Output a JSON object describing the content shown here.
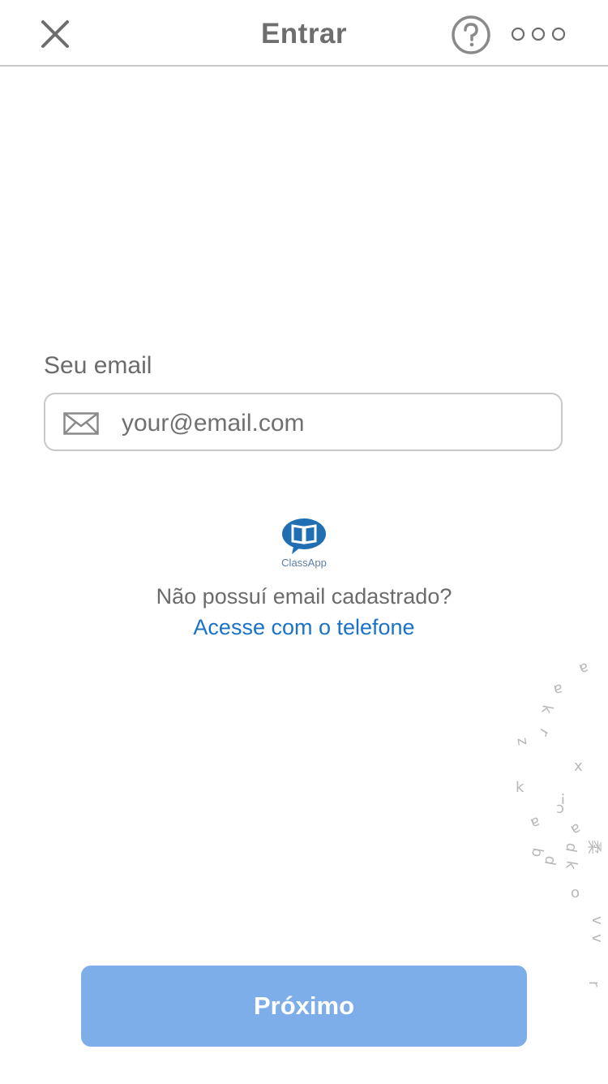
{
  "header": {
    "title": "Entrar",
    "close_icon": "close-icon",
    "help_icon": "help-circle-icon",
    "more_icon": "more-dots-icon"
  },
  "form": {
    "email_label": "Seu email",
    "email_placeholder": "your@email.com",
    "email_value": "",
    "email_icon": "envelope-icon"
  },
  "brand": {
    "logo_text": "ClassApp",
    "logo_color": "#1f6fb2"
  },
  "links": {
    "no_email_text": "Não possuí email cadastrado?",
    "phone_link": "Acesse com o telefone"
  },
  "footer": {
    "next_label": "Próximo"
  },
  "colors": {
    "accent": "#1a73c8",
    "button_bg": "#7eaee9",
    "text": "#6b6b6b"
  }
}
